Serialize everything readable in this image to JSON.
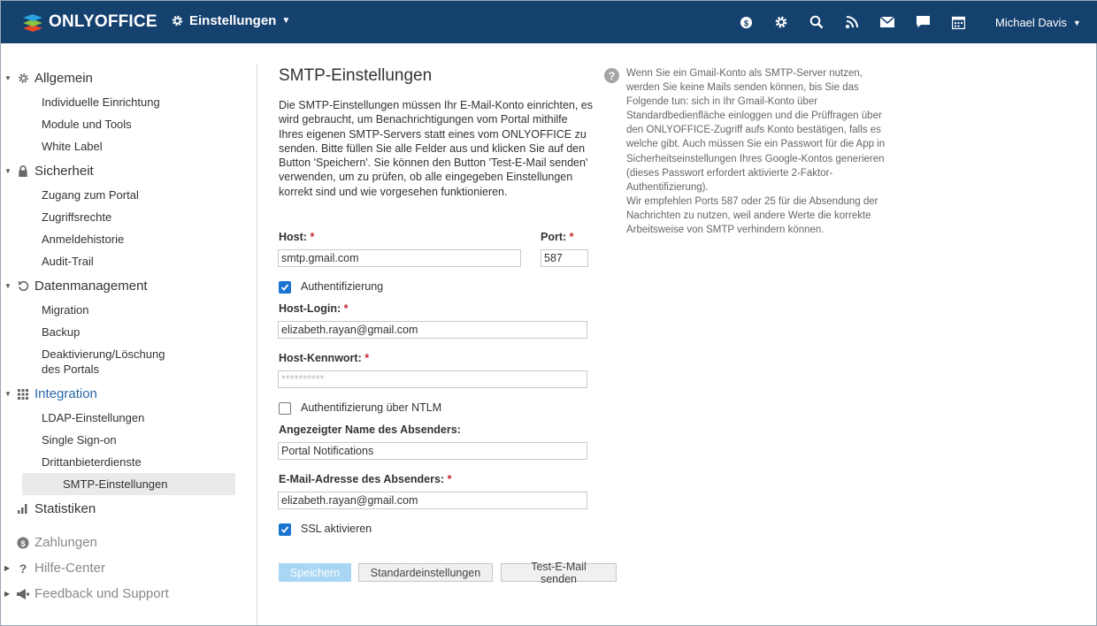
{
  "topbar": {
    "logo_text": "ONLYOFFICE",
    "module_label": "Einstellungen",
    "user_name": "Michael Davis",
    "icons": [
      "payments-icon",
      "settings-icon",
      "search-icon",
      "feed-icon",
      "mail-icon",
      "chat-icon",
      "calendar-icon"
    ],
    "bg_color": "#15416f"
  },
  "sidebar": {
    "sections": [
      {
        "label": "Allgemein",
        "icon": "gear-icon",
        "items": [
          "Individuelle Einrichtung",
          "Module und Tools",
          "White Label"
        ]
      },
      {
        "label": "Sicherheit",
        "icon": "lock-icon",
        "items": [
          "Zugang zum Portal",
          "Zugriffsrechte",
          "Anmeldehistorie",
          "Audit-Trail"
        ]
      },
      {
        "label": "Datenmanagement",
        "icon": "restore-icon",
        "items": [
          "Migration",
          "Backup",
          "Deaktivierung/Löschung des Portals"
        ]
      },
      {
        "label": "Integration",
        "icon": "grid-icon",
        "items": [
          "LDAP-Einstellungen",
          "Single Sign-on",
          "Drittanbieterdienste",
          "SMTP-Einstellungen"
        ]
      },
      {
        "label": "Statistiken",
        "icon": "chart-icon",
        "items": []
      },
      {
        "label": "Zahlungen",
        "icon": "payments-icon",
        "items": []
      },
      {
        "label": "Hilfe-Center",
        "icon": "question-icon",
        "items": []
      },
      {
        "label": "Feedback und Support",
        "icon": "megaphone-icon",
        "items": []
      }
    ],
    "selected_item": "SMTP-Einstellungen",
    "active_color": "#2a68a8"
  },
  "main": {
    "title": "SMTP-Einstellungen",
    "description": "Die SMTP-Einstellungen müssen Ihr E-Mail-Konto einrichten, es wird gebraucht, um Benachrichtigungen vom Portal mithilfe Ihres eigenen SMTP-Servers statt eines vom ONLYOFFICE zu senden. Bitte füllen Sie alle Felder aus und klicken Sie auf den Button 'Speichern'. Sie können den Button 'Test-E-Mail senden' verwenden, um zu prüfen, ob alle eingegeben Einstellungen korrekt sind und wie vorgesehen funktionieren.",
    "required_mark": "*",
    "host_label": "Host:",
    "host_value": "smtp.gmail.com",
    "port_label": "Port:",
    "port_value": "587",
    "auth_label": "Authentifizierung",
    "auth_checked": true,
    "login_label": "Host-Login:",
    "login_value": "elizabeth.rayan@gmail.com",
    "password_label": "Host-Kennwort:",
    "password_placeholder": "**********",
    "ntlm_label": "Authentifizierung über NTLM",
    "ntlm_checked": false,
    "sender_name_label": "Angezeigter Name des Absenders:",
    "sender_name_value": "Portal Notifications",
    "sender_email_label": "E-Mail-Adresse des Absenders:",
    "sender_email_value": "elizabeth.rayan@gmail.com",
    "ssl_label": "SSL aktivieren",
    "ssl_checked": true,
    "buttons": {
      "save": "Speichern",
      "defaults": "Standardeinstellungen",
      "test": "Test-E-Mail senden"
    }
  },
  "help": {
    "icon": "question-icon",
    "text": "Wenn Sie ein Gmail-Konto als SMTP-Server nutzen, werden Sie keine Mails senden können, bis Sie das Folgende tun: sich in Ihr Gmail-Konto über Standardbedienfläche einloggen und die Prüffragen über den ONLYOFFICE-Zugriff aufs Konto bestätigen, falls es welche gibt. Auch müssen Sie ein Passwort für die App in Sicherheitseinstellungen Ihres Google-Kontos generieren (dieses Passwort erfordert aktivierte 2-Faktor-Authentifizierung).",
    "text2": "Wir empfehlen Ports 587 oder 25 für die Absendung der Nachrichten zu nutzen, weil andere Werte die korrekte Arbeitsweise von SMTP verhindern können."
  }
}
